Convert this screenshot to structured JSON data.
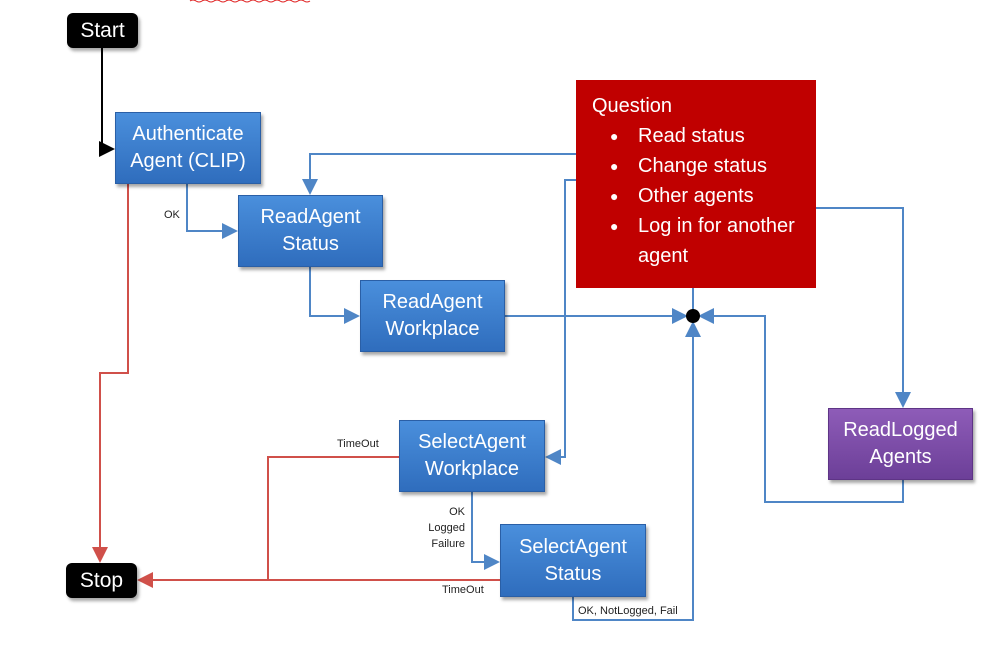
{
  "nodes": {
    "start": "Start",
    "stop": "Stop",
    "authenticate": [
      "Authenticate",
      "Agent (CLIP)"
    ],
    "read_agent_status": [
      "ReadAgent",
      "Status"
    ],
    "read_agent_workplace": [
      "ReadAgent",
      "Workplace"
    ],
    "select_agent_workplace": [
      "SelectAgent",
      "Workplace"
    ],
    "select_agent_status": [
      "SelectAgent",
      "Status"
    ],
    "read_logged_agents": [
      "ReadLogged",
      "Agents"
    ]
  },
  "question": {
    "title": "Question",
    "items": [
      "Read status",
      "Change status",
      "Other agents",
      "Log in for another agent"
    ]
  },
  "edge_labels": {
    "ok": "OK",
    "timeout_1": "TimeOut",
    "timeout_2": "TimeOut",
    "select_workplace_results": [
      "OK",
      "Logged",
      "Failure"
    ],
    "select_status_results": "OK, NotLogged, Fail"
  },
  "colors": {
    "process": "#3a7dcc",
    "question": "#c00000",
    "terminal": "#000000",
    "read_logged": "#7b4aa8",
    "error_edge": "#d0504a",
    "flow_edge": "#4f86c6"
  }
}
